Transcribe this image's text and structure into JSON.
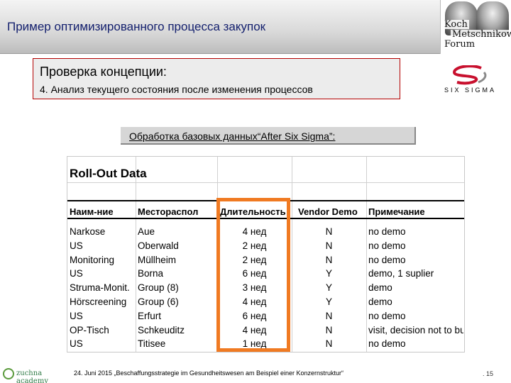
{
  "header": {
    "title": "Пример оптимизированного процесса закупок",
    "logo_words": [
      "Koch",
      "Metschnikow",
      "Forum"
    ]
  },
  "concept": {
    "title": "Проверка концепции:",
    "subtitle": "4. Анализ текущего состояния после изменения процессов"
  },
  "sixsigma": {
    "label": "SIX SIGMA",
    "color": "#c8102e"
  },
  "process": {
    "label": "Обработка базовых данных“After Six Sigma”:"
  },
  "rollout": {
    "title": "Roll-Out Data",
    "headers": [
      "Наим-ние",
      "Местораспол",
      "Длительность",
      "Vendor Demo",
      "Примечание"
    ],
    "rows": [
      [
        "Narkose",
        "Aue",
        "4 нед",
        "N",
        "no demo"
      ],
      [
        "US",
        "Oberwald",
        "2 нед",
        "N",
        "no demo"
      ],
      [
        "Monitoring",
        "Müllheim",
        "2 нед",
        "N",
        "no demo"
      ],
      [
        "US",
        "Borna",
        "6 нед",
        "Y",
        "demo, 1 suplier"
      ],
      [
        "Struma-Monit.",
        "Group (8)",
        "3 нед",
        "Y",
        "demo"
      ],
      [
        "Hörscreening",
        "Group (6)",
        "4 нед",
        "Y",
        "demo"
      ],
      [
        "US",
        "Erfurt",
        "6 нед",
        "N",
        "no demo"
      ],
      [
        "OP-Tisch",
        "Schkeuditz",
        "4 нед",
        "N",
        "visit, decision not to buy"
      ],
      [
        "US",
        "Titisee",
        "1 нед",
        "N",
        "no demo"
      ]
    ],
    "highlight_color": "#f07a22"
  },
  "footer": {
    "logo_name": "zuchna academy",
    "text": "24. Juni 2015 „Beschaffungsstrategie im Gesundheitswesen am Beispiel einer Konzernstruktur“",
    "page": ". 15"
  }
}
